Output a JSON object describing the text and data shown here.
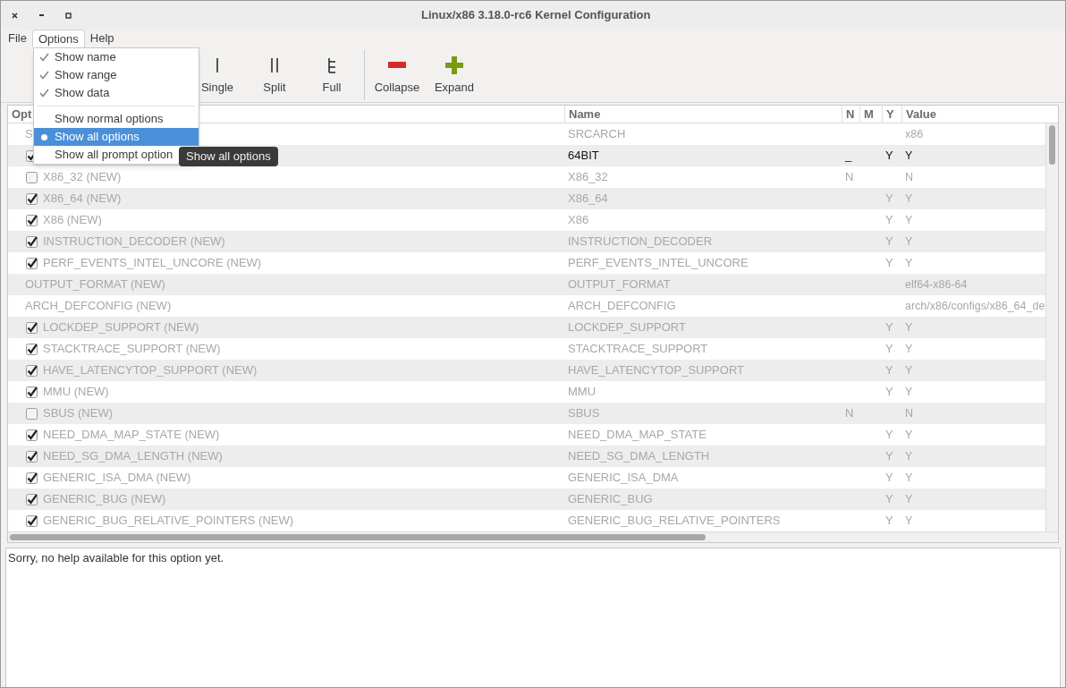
{
  "window": {
    "title": "Linux/x86 3.18.0-rc6 Kernel Configuration"
  },
  "menubar": [
    {
      "label": "File",
      "selected": false
    },
    {
      "label": "Options",
      "selected": true
    },
    {
      "label": "Help",
      "selected": false
    }
  ],
  "toolbar": [
    {
      "kind": "single",
      "label": "Single"
    },
    {
      "kind": "split",
      "label": "Split"
    },
    {
      "kind": "full",
      "label": "Full"
    },
    {
      "kind": "separator"
    },
    {
      "kind": "collapse",
      "label": "Collapse"
    },
    {
      "kind": "expand",
      "label": "Expand"
    }
  ],
  "options_menu": [
    {
      "kind": "check",
      "label": "Show name",
      "checked": true
    },
    {
      "kind": "check",
      "label": "Show range",
      "checked": true
    },
    {
      "kind": "check",
      "label": "Show data",
      "checked": true
    },
    {
      "kind": "separator"
    },
    {
      "kind": "radio",
      "label": "Show normal options",
      "selected": false
    },
    {
      "kind": "radio",
      "label": "Show all options",
      "selected": true
    },
    {
      "kind": "radio",
      "label": "Show all prompt option",
      "selected": false
    }
  ],
  "tooltip": "Show all options",
  "table": {
    "columns": [
      "Opt",
      "Name",
      "N",
      "M",
      "Y",
      "Value"
    ],
    "rows": [
      {
        "option": "S",
        "name": "SRCARCH",
        "n": "",
        "m": "",
        "y": "",
        "value": "x86",
        "disabled": true
      },
      {
        "checked": true,
        "name": "64BIT",
        "n": "_",
        "m": "",
        "y": "Y",
        "value": "Y",
        "disabled": false
      },
      {
        "option": "X86_32 (NEW)",
        "checked": false,
        "name": "X86_32",
        "n": "N",
        "m": "",
        "y": "",
        "value": "N",
        "disabled": true
      },
      {
        "option": "X86_64 (NEW)",
        "checked": true,
        "name": "X86_64",
        "n": "",
        "m": "",
        "y": "Y",
        "value": "Y",
        "disabled": true
      },
      {
        "option": "X86 (NEW)",
        "checked": true,
        "name": "X86",
        "n": "",
        "m": "",
        "y": "Y",
        "value": "Y",
        "disabled": true
      },
      {
        "option": "INSTRUCTION_DECODER (NEW)",
        "checked": true,
        "name": "INSTRUCTION_DECODER",
        "n": "",
        "m": "",
        "y": "Y",
        "value": "Y",
        "disabled": true
      },
      {
        "option": "PERF_EVENTS_INTEL_UNCORE (NEW)",
        "checked": true,
        "name": "PERF_EVENTS_INTEL_UNCORE",
        "n": "",
        "m": "",
        "y": "Y",
        "value": "Y",
        "disabled": true
      },
      {
        "option": "OUTPUT_FORMAT (NEW)",
        "name": "OUTPUT_FORMAT",
        "n": "",
        "m": "",
        "y": "",
        "value": "elf64-x86-64",
        "disabled": true
      },
      {
        "option": "ARCH_DEFCONFIG (NEW)",
        "name": "ARCH_DEFCONFIG",
        "n": "",
        "m": "",
        "y": "",
        "value": "arch/x86/configs/x86_64_de",
        "disabled": true
      },
      {
        "option": "LOCKDEP_SUPPORT (NEW)",
        "checked": true,
        "name": "LOCKDEP_SUPPORT",
        "n": "",
        "m": "",
        "y": "Y",
        "value": "Y",
        "disabled": true
      },
      {
        "option": "STACKTRACE_SUPPORT (NEW)",
        "checked": true,
        "name": "STACKTRACE_SUPPORT",
        "n": "",
        "m": "",
        "y": "Y",
        "value": "Y",
        "disabled": true
      },
      {
        "option": "HAVE_LATENCYTOP_SUPPORT (NEW)",
        "checked": true,
        "name": "HAVE_LATENCYTOP_SUPPORT",
        "n": "",
        "m": "",
        "y": "Y",
        "value": "Y",
        "disabled": true
      },
      {
        "option": "MMU (NEW)",
        "checked": true,
        "name": "MMU",
        "n": "",
        "m": "",
        "y": "Y",
        "value": "Y",
        "disabled": true
      },
      {
        "option": "SBUS (NEW)",
        "checked": false,
        "name": "SBUS",
        "n": "N",
        "m": "",
        "y": "",
        "value": "N",
        "disabled": true
      },
      {
        "option": "NEED_DMA_MAP_STATE (NEW)",
        "checked": true,
        "name": "NEED_DMA_MAP_STATE",
        "n": "",
        "m": "",
        "y": "Y",
        "value": "Y",
        "disabled": true
      },
      {
        "option": "NEED_SG_DMA_LENGTH (NEW)",
        "checked": true,
        "name": "NEED_SG_DMA_LENGTH",
        "n": "",
        "m": "",
        "y": "Y",
        "value": "Y",
        "disabled": true
      },
      {
        "option": "GENERIC_ISA_DMA (NEW)",
        "checked": true,
        "name": "GENERIC_ISA_DMA",
        "n": "",
        "m": "",
        "y": "Y",
        "value": "Y",
        "disabled": true
      },
      {
        "option": "GENERIC_BUG (NEW)",
        "checked": true,
        "name": "GENERIC_BUG",
        "n": "",
        "m": "",
        "y": "Y",
        "value": "Y",
        "disabled": true
      },
      {
        "option": "GENERIC_BUG_RELATIVE_POINTERS (NEW)",
        "checked": true,
        "name": "GENERIC_BUG_RELATIVE_POINTERS",
        "n": "",
        "m": "",
        "y": "Y",
        "value": "Y",
        "disabled": true
      }
    ]
  },
  "help_text": "Sorry, no help available for this option yet."
}
